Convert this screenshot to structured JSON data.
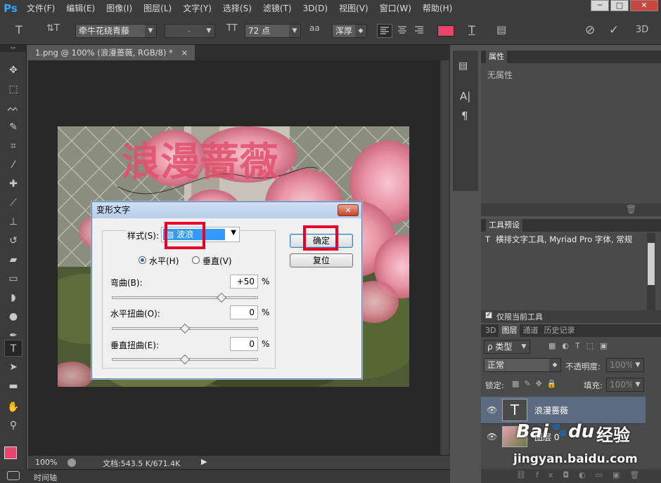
{
  "app": {
    "logo": "Ps"
  },
  "menu": [
    "文件(F)",
    "编辑(E)",
    "图像(I)",
    "图层(L)",
    "文字(Y)",
    "选择(S)",
    "滤镜(T)",
    "3D(D)",
    "视图(V)",
    "窗口(W)",
    "帮助(H)"
  ],
  "window_controls": {
    "minimize": "─",
    "maximize": "□",
    "close": "✕"
  },
  "options": {
    "tool_icon": "T",
    "orient_icon": "⇅T",
    "font_family": "牵牛花绕青藤",
    "font_style": "-",
    "size_icon": "TT",
    "font_size": "72 点",
    "aa_icon": "aa",
    "antialias": "浑厚",
    "warp_icon": "T",
    "panel_icon": "▤",
    "cancel_icon": "⊘",
    "commit_icon": "✓",
    "threed": "3D",
    "text_color": "#e8446c"
  },
  "document": {
    "tab_label": "1.png @ 100% (浪漫蔷薇, RGB/8) *",
    "tab_close": "×",
    "warped_text": "浪漫蔷薇",
    "zoom": "100%",
    "doc_info": "文档:543.5 K/671.4K",
    "timeline": "时间轴"
  },
  "dialog": {
    "title": "变形文字",
    "close": "✕",
    "style_label": "样式(S):",
    "style_value": "波浪",
    "ok": "确定",
    "reset": "复位",
    "horizontal": "水平(H)",
    "vertical": "垂直(V)",
    "bend_label": "弯曲(B):",
    "bend_value": "+50",
    "hdist_label": "水平扭曲(O):",
    "hdist_value": "0",
    "vdist_label": "垂直扭曲(E):",
    "vdist_value": "0",
    "percent": "%",
    "bend_fraction": 0.75,
    "hdist_fraction": 0.5,
    "vdist_fraction": 0.5
  },
  "properties": {
    "title": "属性",
    "empty": "无属性"
  },
  "tool_presets": {
    "title": "工具预设",
    "item": "横排文字工具, Myriad Pro 字体, 常规",
    "current_only": "仅限当前工具"
  },
  "layers": {
    "tabs": [
      "3D",
      "图层",
      "通道",
      "历史记录"
    ],
    "filter_label": "ρ 类型",
    "blend_mode": "正常",
    "opacity_label": "不透明度:",
    "opacity": "100%",
    "lock_label": "锁定:",
    "fill_label": "填充:",
    "fill": "100%",
    "items": [
      {
        "name": "浪漫蔷薇",
        "thumb": "T"
      },
      {
        "name": "图层 0",
        "thumb": ""
      }
    ]
  },
  "watermark": {
    "brand": "Bai",
    "brand2": "du",
    "brand_cn": "经验",
    "url": "jingyan.baidu.com"
  }
}
